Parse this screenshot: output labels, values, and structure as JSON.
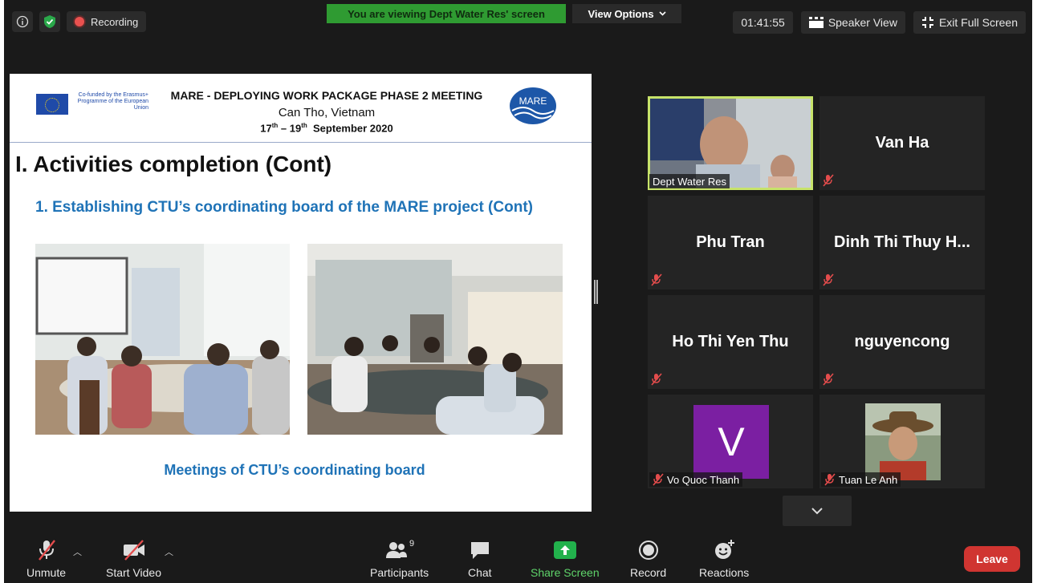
{
  "topbar": {
    "recording_label": "Recording",
    "banner": "You are viewing Dept Water Res' screen",
    "view_options": "View Options",
    "timer": "01:41:55",
    "speaker_view": "Speaker View",
    "exit_full_screen": "Exit Full Screen"
  },
  "slide": {
    "eu_text": "Co-funded by the Erasmus+ Programme of the European Union",
    "header_title": "MARE - DEPLOYING WORK PACKAGE PHASE 2 MEETING",
    "header_place": "Can Tho, Vietnam",
    "header_date_start": "17",
    "header_date_sup1": "th",
    "header_date_mid": " – 19",
    "header_date_sup2": "th",
    "header_date_end": "  September 2020",
    "logo_text": "MARE",
    "heading": "I. Activities completion (Cont)",
    "subheading": "1. Establishing CTU’s coordinating board of the MARE project (Cont)",
    "caption": "Meetings of CTU’s coordinating board"
  },
  "participants": [
    {
      "name": "Dept Water Res",
      "active": true,
      "muted": false
    },
    {
      "name": "Van Ha",
      "muted": true
    },
    {
      "name": "Phu Tran",
      "muted": true
    },
    {
      "name": "Dinh Thi Thuy H...",
      "muted": true
    },
    {
      "name": "Ho Thi Yen Thu",
      "muted": true
    },
    {
      "name": "nguyencong",
      "muted": true
    },
    {
      "name": "Vo Quoc Thanh",
      "initial": "V",
      "muted": true
    },
    {
      "name": "Tuan Le Anh",
      "muted": true
    }
  ],
  "toolbar": {
    "unmute": "Unmute",
    "start_video": "Start Video",
    "participants": "Participants",
    "participants_count": "9",
    "chat": "Chat",
    "share_screen": "Share Screen",
    "record": "Record",
    "reactions": "Reactions",
    "leave": "Leave"
  },
  "colors": {
    "banner_green": "#2f9b32",
    "active_speaker": "#c7e36a",
    "leave_red": "#d03531",
    "share_green": "#22b14c",
    "slide_blue": "#1f73b7",
    "avatar_purple": "#7b1fa2"
  },
  "icons": [
    "info-icon",
    "shield-check-icon",
    "record-dot-icon",
    "chevron-down-icon",
    "speaker-view-icon",
    "exit-full-screen-icon",
    "mic-muted-icon",
    "video-off-icon",
    "participants-icon",
    "chat-icon",
    "share-screen-icon",
    "record-icon",
    "reactions-icon"
  ]
}
